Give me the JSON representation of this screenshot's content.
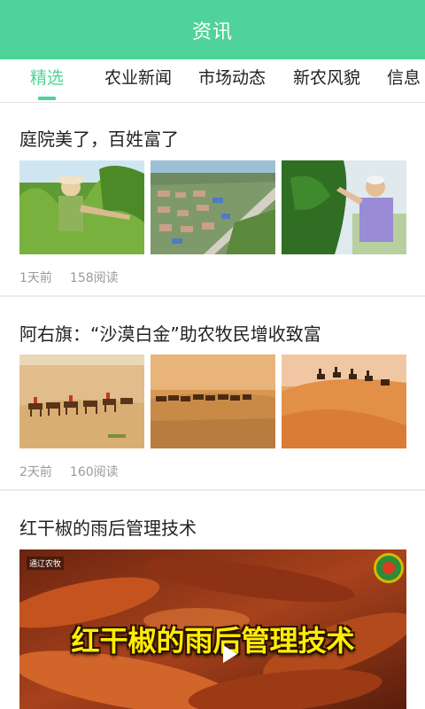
{
  "header": {
    "title": "资讯"
  },
  "tabs": [
    {
      "label": "精选",
      "active": true
    },
    {
      "label": "农业新闻",
      "active": false
    },
    {
      "label": "市场动态",
      "active": false
    },
    {
      "label": "新农风貌",
      "active": false
    },
    {
      "label": "信息",
      "active": false
    }
  ],
  "articles": [
    {
      "title": "庭院美了，百姓富了",
      "time": "1天前",
      "reads": "158阅读",
      "image_subjects": [
        "farmer-in-garden",
        "aerial-village",
        "elder-farmer-picking"
      ]
    },
    {
      "title": "阿右旗：“沙漠白金”助农牧民增收致富",
      "time": "2天前",
      "reads": "160阅读",
      "image_subjects": [
        "camel-caravan",
        "camel-herd",
        "camels-on-dune"
      ]
    },
    {
      "title": "红干椒的雨后管理技术",
      "video": {
        "caption": "红干椒的雨后管理技术",
        "source": "通辽农牧",
        "play_icon": "play-icon"
      }
    }
  ],
  "colors": {
    "accent": "#4fd39a",
    "meta": "#9a9a9a",
    "divider": "#ececec"
  }
}
